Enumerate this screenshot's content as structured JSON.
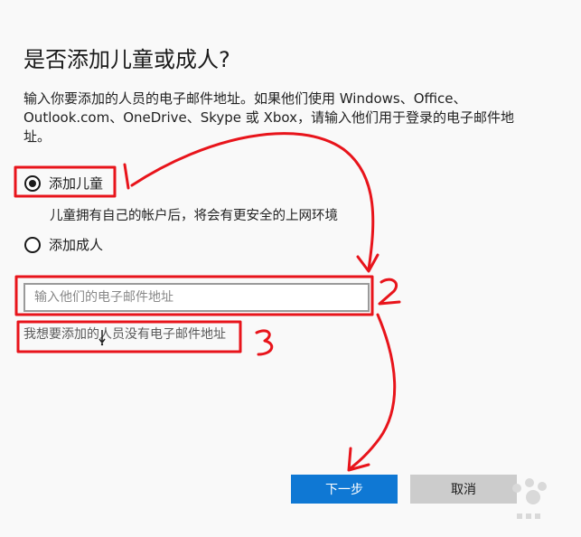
{
  "dialog": {
    "title": "是否添加儿童或成人?",
    "description": "输入你要添加的人员的电子邮件地址。如果他们使用 Windows、Office、Outlook.com、OneDrive、Skype 或 Xbox，请输入他们用于登录的电子邮件地址。",
    "options": {
      "child_label": "添加儿童",
      "child_selected": true,
      "child_description": "儿童拥有自己的帐户后，将会有更安全的上网环境",
      "adult_label": "添加成人",
      "adult_selected": false
    },
    "email": {
      "value": "",
      "placeholder": "输入他们的电子邮件地址"
    },
    "no_email_link": "我想要添加的人员没有电子邮件地址",
    "buttons": {
      "next": "下一步",
      "cancel": "取消"
    }
  },
  "annotations": {
    "labels": [
      "1",
      "2",
      "3"
    ],
    "color": "#e8141b"
  },
  "colors": {
    "primary_button": "#0f78d4",
    "secondary_button": "#cccccc"
  }
}
